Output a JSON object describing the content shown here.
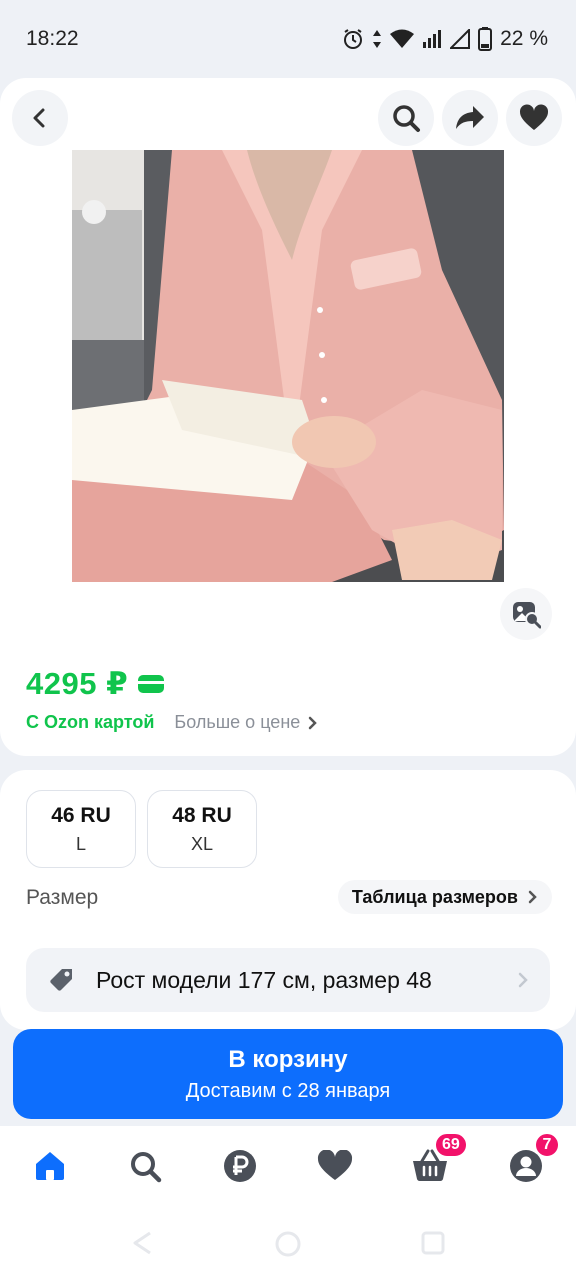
{
  "status_bar": {
    "time": "18:22",
    "battery": "22 %"
  },
  "product": {
    "image_alt": "Pink satin pajama set",
    "price": "4295 ₽",
    "ozon_card_label": "С Ozon картой",
    "more_price_label": "Больше о цене"
  },
  "sizes": {
    "options": [
      {
        "size": "46 RU",
        "letter": "L"
      },
      {
        "size": "48 RU",
        "letter": "XL"
      }
    ],
    "label": "Размер",
    "table_link": "Таблица размеров",
    "model_info": "Рост модели 177 см, размер 48"
  },
  "cart_button": {
    "title": "В корзину",
    "subtitle": "Доставим с 28 января"
  },
  "tab_bar": {
    "cart_badge": "69",
    "profile_badge": "7"
  },
  "colors": {
    "accent_blue": "#0d6efd",
    "price_green": "#10c44c",
    "badge_pink": "#f2126a"
  },
  "icons": [
    "back-icon",
    "search-icon",
    "share-icon",
    "heart-icon",
    "image-search-icon",
    "tag-icon",
    "home-icon",
    "ruble-icon",
    "basket-icon",
    "profile-icon"
  ]
}
